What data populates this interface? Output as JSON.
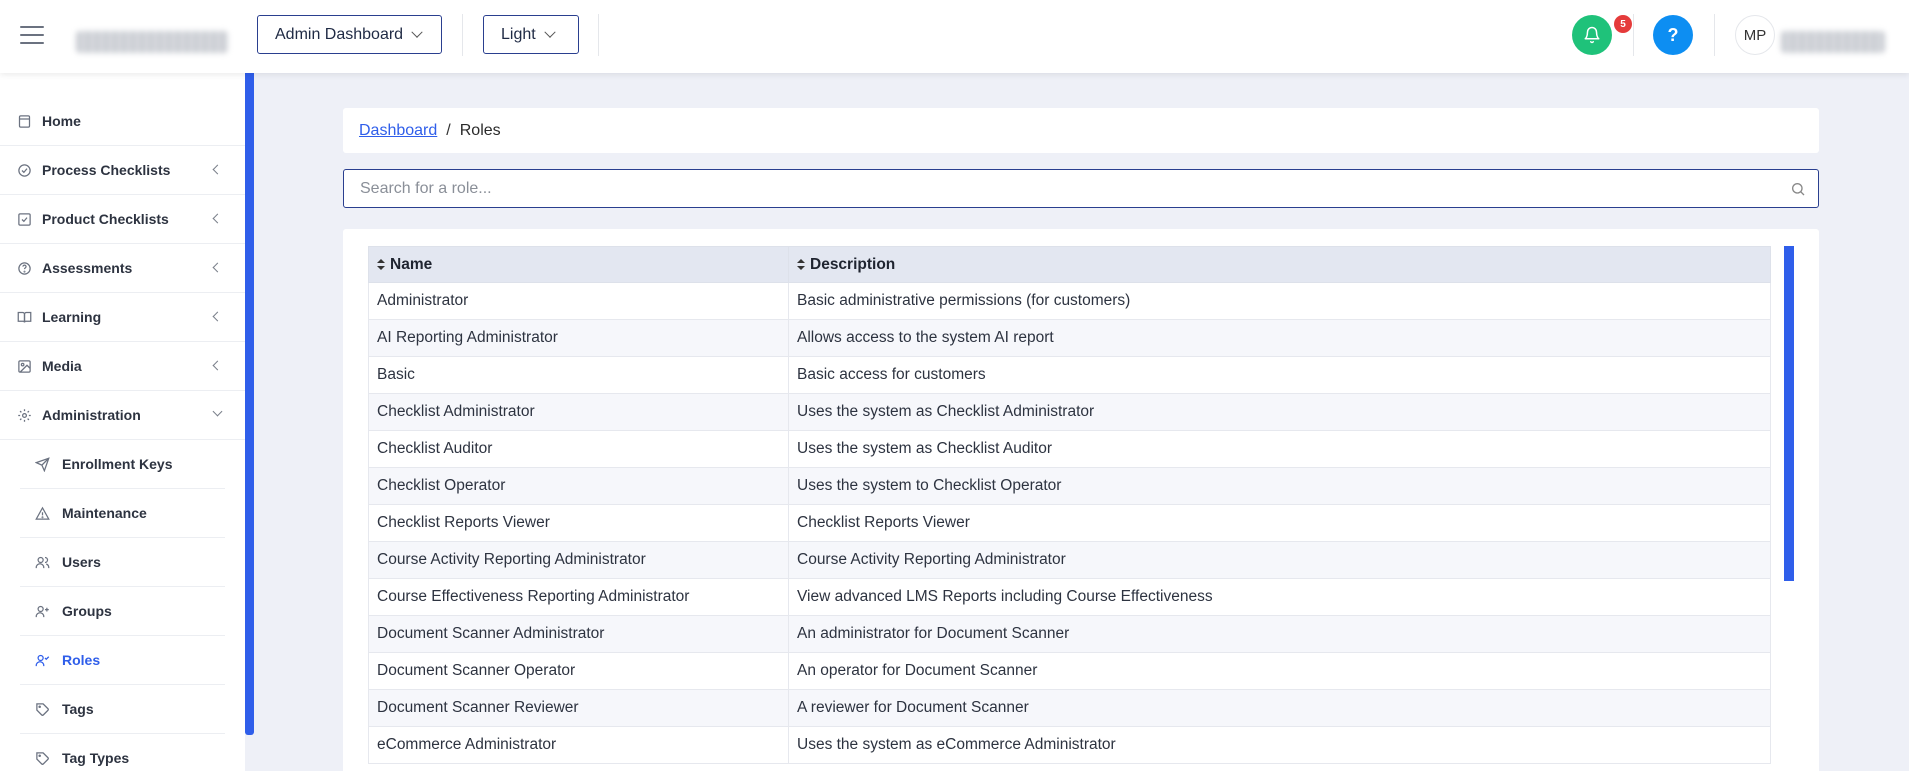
{
  "header": {
    "dashboard_select": "Admin Dashboard",
    "theme_select": "Light",
    "notification_count": "5",
    "help_label": "?",
    "user_initials": "MP"
  },
  "sidebar": {
    "items": [
      {
        "label": "Home",
        "icon": "home-icon"
      },
      {
        "label": "Process Checklists",
        "icon": "check-circle-icon"
      },
      {
        "label": "Product Checklists",
        "icon": "check-square-icon"
      },
      {
        "label": "Assessments",
        "icon": "question-circle-icon"
      },
      {
        "label": "Learning",
        "icon": "book-icon"
      },
      {
        "label": "Media",
        "icon": "image-icon"
      },
      {
        "label": "Administration",
        "icon": "gear-icon"
      }
    ],
    "admin_subitems": [
      {
        "label": "Enrollment Keys",
        "icon": "send-icon"
      },
      {
        "label": "Maintenance",
        "icon": "warning-icon"
      },
      {
        "label": "Users",
        "icon": "users-icon"
      },
      {
        "label": "Groups",
        "icon": "user-plus-icon"
      },
      {
        "label": "Roles",
        "icon": "user-check-icon"
      },
      {
        "label": "Tags",
        "icon": "tag-icon"
      },
      {
        "label": "Tag Types",
        "icon": "tag-icon"
      }
    ]
  },
  "breadcrumb": {
    "parent": "Dashboard",
    "separator": "/",
    "current": "Roles"
  },
  "search": {
    "placeholder": "Search for a role..."
  },
  "table": {
    "columns": [
      "Name",
      "Description"
    ],
    "rows": [
      [
        "Administrator",
        "Basic administrative permissions (for customers)"
      ],
      [
        "AI Reporting Administrator",
        "Allows access to the system AI report"
      ],
      [
        "Basic",
        "Basic access for customers"
      ],
      [
        "Checklist Administrator",
        "Uses the system as Checklist Administrator"
      ],
      [
        "Checklist Auditor",
        "Uses the system as Checklist Auditor"
      ],
      [
        "Checklist Operator",
        "Uses the system to Checklist Operator"
      ],
      [
        "Checklist Reports Viewer",
        "Checklist Reports Viewer"
      ],
      [
        "Course Activity Reporting Administrator",
        "Course Activity Reporting Administrator"
      ],
      [
        "Course Effectiveness Reporting Administrator",
        "View advanced LMS Reports including Course Effectiveness"
      ],
      [
        "Document Scanner Administrator",
        "An administrator for Document Scanner"
      ],
      [
        "Document Scanner Operator",
        "An operator for Document Scanner"
      ],
      [
        "Document Scanner Reviewer",
        "A reviewer for Document Scanner"
      ],
      [
        "eCommerce Administrator",
        "Uses the system as eCommerce Administrator"
      ]
    ]
  },
  "colors": {
    "accent": "#2f5eea",
    "notification_green": "#1fc27a",
    "help_blue": "#0d8ef2",
    "badge_red": "#e53b3b"
  }
}
